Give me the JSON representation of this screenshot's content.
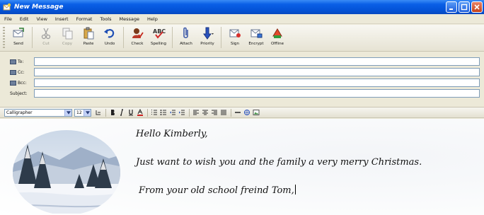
{
  "window": {
    "title": "New Message"
  },
  "menu": [
    "File",
    "Edit",
    "View",
    "Insert",
    "Format",
    "Tools",
    "Message",
    "Help"
  ],
  "toolbar": {
    "send": "Send",
    "cut": "Cut",
    "copy": "Copy",
    "paste": "Paste",
    "undo": "Undo",
    "check": "Check",
    "spelling": "Spelling",
    "attach": "Attach",
    "priority": "Priority",
    "sign": "Sign",
    "encrypt": "Encrypt",
    "offline": "Offline"
  },
  "address": {
    "to_label": "To:",
    "cc_label": "Cc:",
    "bcc_label": "Bcc:",
    "subject_label": "Subject:",
    "to_value": "",
    "cc_value": "",
    "bcc_value": "",
    "subject_value": ""
  },
  "format": {
    "font": "Calligrapher",
    "size": "12"
  },
  "message": {
    "greeting": "Hello Kimberly,",
    "line1": "Just want to wish you and the family a very merry Christmas.",
    "line2": "From your old school freind Tom,"
  }
}
